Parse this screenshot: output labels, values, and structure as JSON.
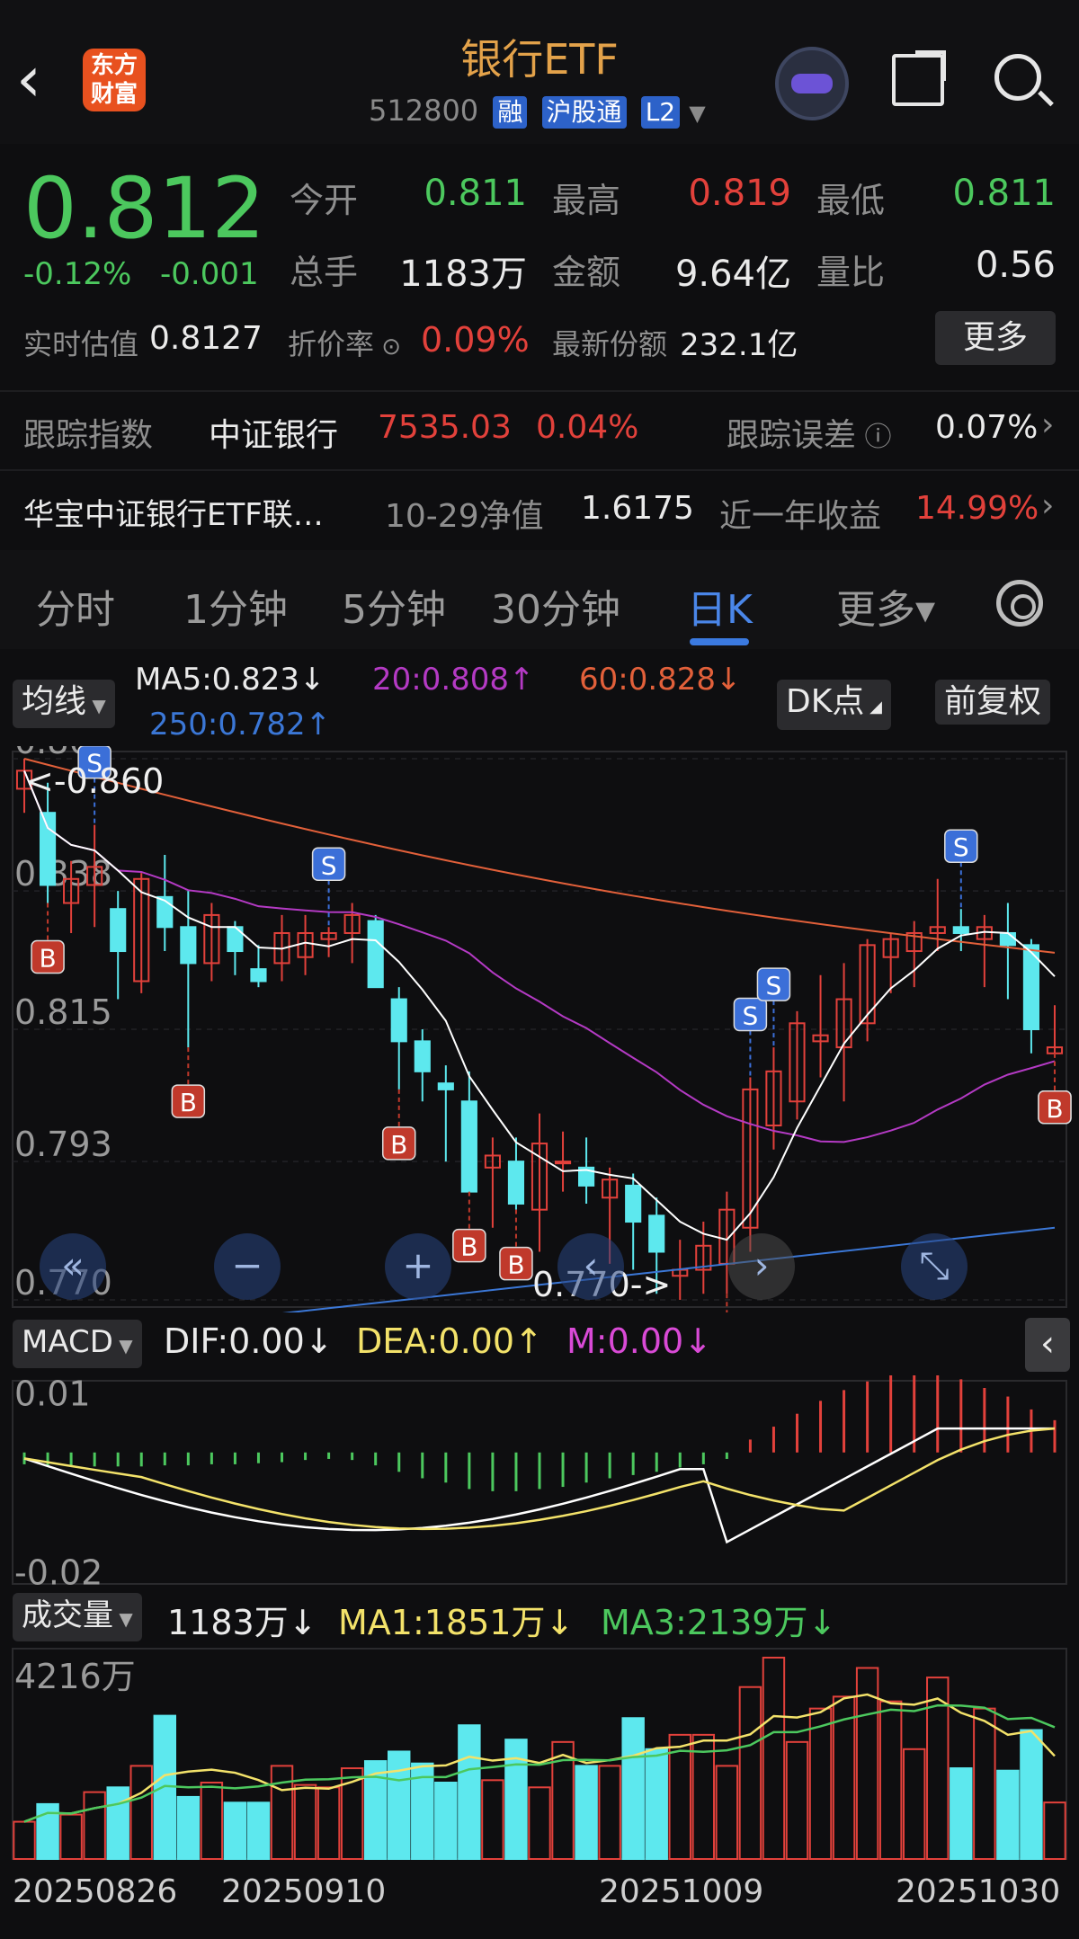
{
  "header": {
    "back_icon": "chevron-left-icon",
    "logo_text": "东方财富",
    "title": "银行ETF",
    "code": "512800",
    "tags": [
      "融",
      "沪股通",
      "L2"
    ]
  },
  "quote": {
    "price": "0.812",
    "pct": "-0.12%",
    "change": "-0.001",
    "open_label": "今开",
    "open": "0.811",
    "high_label": "最高",
    "high": "0.819",
    "low_label": "最低",
    "low": "0.811",
    "vol_label": "总手",
    "vol": "1183万",
    "amt_label": "金额",
    "amt": "9.64亿",
    "ratio_label": "量比",
    "ratio": "0.56",
    "iopv_label": "实时估值",
    "iopv": "0.8127",
    "premium_label": "折价率",
    "premium": "0.09%",
    "shares_label": "最新份额",
    "shares": "232.1亿",
    "more_label": "更多"
  },
  "tracking": {
    "label": "跟踪指数",
    "index": "中证银行",
    "index_value": "7535.03",
    "index_pct": "0.04%",
    "error_label": "跟踪误差",
    "error": "0.07%"
  },
  "fund": {
    "name": "华宝中证银行ETF联…",
    "nav_label": "10-29净值",
    "nav": "1.6175",
    "ret_label": "近一年收益",
    "ret": "14.99%"
  },
  "tabs": [
    "分时",
    "1分钟",
    "5分钟",
    "30分钟",
    "日K",
    "更多▾"
  ],
  "active_tab": "日K",
  "ma_bar": {
    "selector": "均线",
    "ma5": "MA5:0.823↓",
    "ma20": "20:0.808↑",
    "ma60": "60:0.828↓",
    "ma250": "250:0.782↑",
    "dk": "DK点",
    "adjust": "前复权"
  },
  "colors": {
    "up": "#e2413b",
    "down": "#5de8ee",
    "ma5": "#ffffff",
    "ma20": "#b43ac4",
    "ma60": "#e2603a",
    "ma250": "#3b77d6",
    "signal_s": "#3b6fd8",
    "signal_b": "#c0392b"
  },
  "chart_data": [
    {
      "type": "candlestick",
      "y_ticks": [
        "0.860",
        "0.838",
        "0.815",
        "0.793",
        "0.770"
      ],
      "ylim": [
        0.77,
        0.86
      ],
      "max_label": "<-0.860",
      "min_label": "0.770->",
      "candles": [
        [
          0.855,
          0.86,
          0.851,
          0.858
        ],
        [
          0.851,
          0.856,
          0.836,
          0.839
        ],
        [
          0.836,
          0.843,
          0.831,
          0.84
        ],
        [
          0.839,
          0.849,
          0.832,
          0.842
        ],
        [
          0.835,
          0.838,
          0.82,
          0.828
        ],
        [
          0.823,
          0.841,
          0.821,
          0.84
        ],
        [
          0.837,
          0.844,
          0.828,
          0.832
        ],
        [
          0.832,
          0.838,
          0.812,
          0.826
        ],
        [
          0.826,
          0.836,
          0.823,
          0.834
        ],
        [
          0.832,
          0.833,
          0.824,
          0.828
        ],
        [
          0.825,
          0.829,
          0.822,
          0.823
        ],
        [
          0.826,
          0.834,
          0.823,
          0.831
        ],
        [
          0.827,
          0.834,
          0.824,
          0.831
        ],
        [
          0.83,
          0.832,
          0.827,
          0.831
        ],
        [
          0.831,
          0.836,
          0.826,
          0.834
        ],
        [
          0.833,
          0.834,
          0.824,
          0.822
        ],
        [
          0.82,
          0.822,
          0.805,
          0.813
        ],
        [
          0.813,
          0.815,
          0.803,
          0.808
        ],
        [
          0.806,
          0.809,
          0.793,
          0.805
        ],
        [
          0.803,
          0.808,
          0.788,
          0.788
        ],
        [
          0.792,
          0.797,
          0.782,
          0.794
        ],
        [
          0.793,
          0.797,
          0.785,
          0.786
        ],
        [
          0.785,
          0.801,
          0.778,
          0.796
        ],
        [
          0.793,
          0.798,
          0.788,
          0.793
        ],
        [
          0.792,
          0.797,
          0.786,
          0.789
        ],
        [
          0.787,
          0.792,
          0.776,
          0.79
        ],
        [
          0.789,
          0.791,
          0.775,
          0.783
        ],
        [
          0.784,
          0.787,
          0.771,
          0.778
        ],
        [
          0.774,
          0.78,
          0.77,
          0.775
        ],
        [
          0.775,
          0.783,
          0.771,
          0.779
        ],
        [
          0.776,
          0.788,
          0.771,
          0.785
        ],
        [
          0.782,
          0.807,
          0.778,
          0.805
        ],
        [
          0.799,
          0.812,
          0.795,
          0.808
        ],
        [
          0.803,
          0.818,
          0.8,
          0.816
        ],
        [
          0.813,
          0.824,
          0.807,
          0.814
        ],
        [
          0.812,
          0.826,
          0.803,
          0.82
        ],
        [
          0.816,
          0.83,
          0.813,
          0.829
        ],
        [
          0.827,
          0.831,
          0.821,
          0.83
        ],
        [
          0.828,
          0.833,
          0.822,
          0.831
        ],
        [
          0.831,
          0.84,
          0.828,
          0.832
        ],
        [
          0.832,
          0.835,
          0.828,
          0.831
        ],
        [
          0.83,
          0.834,
          0.822,
          0.832
        ],
        [
          0.831,
          0.836,
          0.82,
          0.829
        ],
        [
          0.829,
          0.83,
          0.811,
          0.815
        ],
        [
          0.811,
          0.819,
          0.811,
          0.812
        ]
      ],
      "series": [
        {
          "name": "MA5"
        },
        {
          "name": "20"
        },
        {
          "name": "60"
        },
        {
          "name": "250"
        }
      ],
      "x_labels": [
        "20250826",
        "20250910",
        "20251009",
        "20251030"
      ]
    },
    {
      "type": "bar",
      "title": "MACD",
      "y_ticks": [
        "0.01",
        "-0.02"
      ],
      "legend": {
        "dif": "DIF:0.00↓",
        "dea": "DEA:0.00↑",
        "m": "M:0.00↓"
      },
      "values": [
        -0.0011,
        -0.0012,
        -0.0012,
        -0.0013,
        -0.0013,
        -0.0013,
        -0.0012,
        -0.0012,
        -0.0011,
        -0.0011,
        -0.001,
        -0.0009,
        -0.0007,
        -0.0006,
        -0.0007,
        -0.0012,
        -0.0018,
        -0.0024,
        -0.0028,
        -0.0034,
        -0.0036,
        -0.0036,
        -0.0034,
        -0.0032,
        -0.0028,
        -0.0024,
        -0.0021,
        -0.0018,
        -0.0014,
        -0.0011,
        -0.0006,
        0.0012,
        0.0024,
        0.0036,
        0.0048,
        0.0058,
        0.0066,
        0.0072,
        0.0072,
        0.0072,
        0.0068,
        0.006,
        0.0052,
        0.004,
        0.003
      ]
    },
    {
      "type": "bar",
      "title": "成交量",
      "y_ticks": [
        "4216万"
      ],
      "legend": {
        "vol": "1183万↓",
        "ma1": "MA1:1851万↓",
        "ma3": "MA3:2139万↓"
      },
      "values": [
        780,
        1150,
        930,
        1400,
        1500,
        1950,
        3000,
        1300,
        1600,
        1180,
        1180,
        1950,
        1550,
        1500,
        1900,
        2050,
        2250,
        2000,
        1600,
        2800,
        1650,
        2500,
        1500,
        2450,
        1950,
        1950,
        2950,
        2300,
        2600,
        2600,
        1950,
        3600,
        4216,
        2450,
        3150,
        3400,
        4000,
        3300,
        2300,
        3800,
        1900,
        3150,
        1850,
        2700,
        1183
      ]
    }
  ],
  "chart_controls": [
    "double-left-icon",
    "zoom-out-icon",
    "zoom-in-icon",
    "left-arrow-icon",
    "right-arrow-icon",
    "expand-icon"
  ],
  "macd_selector": "MACD",
  "vol_selector": "成交量"
}
